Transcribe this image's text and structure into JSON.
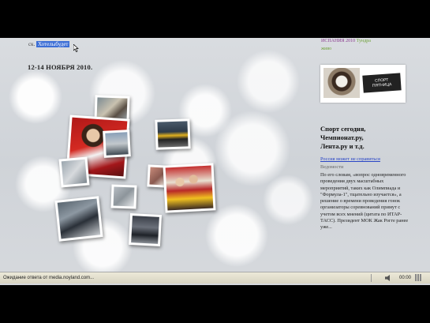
{
  "left": {
    "prefix": "ск.",
    "selected_text": "Хотелыбудет",
    "event_date": "12-14 НОЯБРЯ 2010."
  },
  "sidebar": {
    "promo_line1": "ИСПАНИЯ 2010",
    "promo_line1_green": "Тундра",
    "promo_line2": "живо",
    "banner_sign_line1": "СПОРТ",
    "banner_sign_line2": "ПЯТНИЦА",
    "headline_line1": "Спорт сегодня,",
    "headline_line2": "Чемпионат.ру,",
    "headline_line3": "Лента.ру и т.д.",
    "link_text": "Россия может не справиться",
    "source": "Ведомости",
    "body": "По его словам, «вопрос одновременного проведения двух масштабных мероприятий, таких как Олимпиада и \"Формула-1\", тщательно изучается», а решение о времени проведения гонок организаторы соревнований примут с учетом всех мнений (цитата по ИТАР-ТАСС). Президент МОК Жак Рогге ранее уже..."
  },
  "statusbar": {
    "text": "Ожидание ответа от media.noyland.com...",
    "time": "00:00"
  },
  "colors": {
    "selection": "#3d6fd6",
    "link": "#2a46c6",
    "promo_purple": "#8a3c8f",
    "promo_green": "#6fa23a"
  }
}
